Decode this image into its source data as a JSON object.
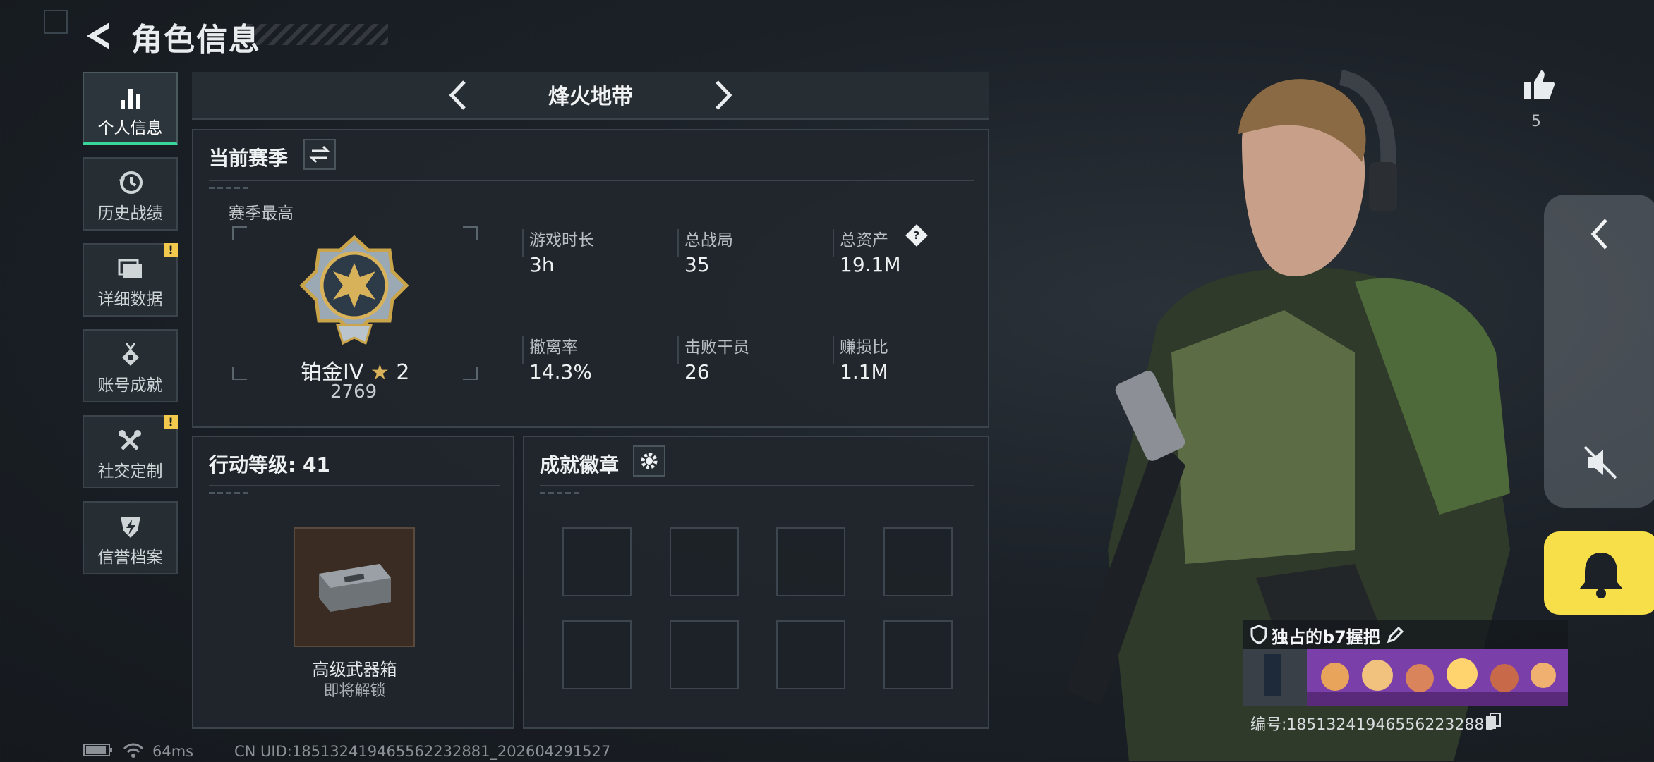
{
  "header": {
    "title": "角色信息"
  },
  "sidebar": {
    "items": [
      {
        "label": "个人信息",
        "icon": "bar-chart-icon",
        "active": true,
        "alert": false
      },
      {
        "label": "历史战绩",
        "icon": "history-icon",
        "active": false,
        "alert": false
      },
      {
        "label": "详细数据",
        "icon": "folder-icon",
        "active": false,
        "alert": true
      },
      {
        "label": "账号成就",
        "icon": "medal-icon",
        "active": false,
        "alert": false
      },
      {
        "label": "社交定制",
        "icon": "tools-icon",
        "active": false,
        "alert": true
      },
      {
        "label": "信誉档案",
        "icon": "shield-bolt-icon",
        "active": false,
        "alert": false
      }
    ],
    "alert_mark": "!"
  },
  "mode": {
    "title": "烽火地带"
  },
  "season": {
    "title": "当前赛季",
    "best_label": "赛季最高",
    "rank_name": "铂金IV",
    "rank_stars": "2",
    "rank_score": "2769",
    "stats": [
      {
        "label": "游戏时长",
        "value": "3h"
      },
      {
        "label": "总战局",
        "value": "35"
      },
      {
        "label": "总资产",
        "value": "19.1M"
      },
      {
        "label": "撤离率",
        "value": "14.3%"
      },
      {
        "label": "击败干员",
        "value": "26"
      },
      {
        "label": "赚损比",
        "value": "1.1M"
      }
    ],
    "help_mark": "?"
  },
  "action_level": {
    "title": "行动等级: 41",
    "reward_name": "高级武器箱",
    "reward_status": "即将解锁"
  },
  "achievements": {
    "title": "成就徽章",
    "slots": 8
  },
  "likes": {
    "count": "5"
  },
  "player": {
    "name": "独占的b7握把",
    "uid_label": "编号:18513241946556223288​1"
  },
  "footer": {
    "ping": "64ms",
    "cn_uid": "CN UID:18513241946556223288​1_202604291527"
  },
  "colors": {
    "accent": "#39d69c",
    "warning": "#f2c94c",
    "bell": "#f7df4a"
  }
}
